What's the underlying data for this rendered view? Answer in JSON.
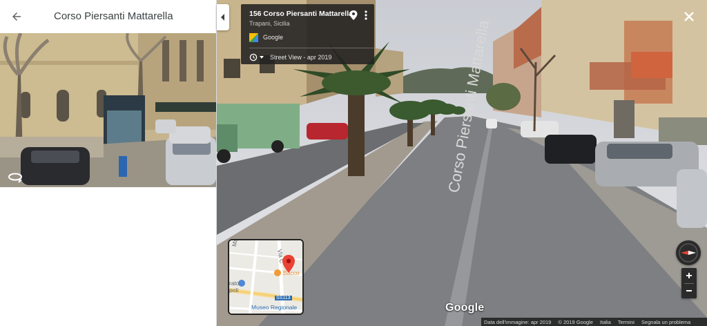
{
  "panel": {
    "title": "Corso Piersanti Mattarella"
  },
  "card": {
    "address": "156 Corso Piersanti Mattarella",
    "city": "Trapani, Sicilia",
    "provider": "Google",
    "history": "Street View - apr 2019"
  },
  "streetview": {
    "road_marking": "Corso Piersanti Mattarella",
    "watermark": "Google"
  },
  "minimap": {
    "labels": {
      "mattarella": "Mattarella",
      "via": "Via C",
      "place": "Bacco",
      "prato": "rato",
      "poli": "poli",
      "road_shield": "SS113",
      "museum": "Museo Regionale"
    }
  },
  "footer": {
    "image_date": "Data dell'immagine: apr 2019",
    "copyright": "© 2019 Google",
    "country": "Italia",
    "terms": "Termini",
    "report": "Segnala un problema"
  },
  "icons": {
    "back": "arrow-back-icon",
    "rotate": "rotate-360-icon",
    "collapse": "chevron-left-icon",
    "pin": "location-pin-icon",
    "more": "more-vert-icon",
    "history": "clock-history-icon",
    "close": "close-icon",
    "compass": "compass-icon"
  },
  "colors": {
    "pin_red": "#ea4335",
    "card_bg": "#222222",
    "road_shield_blue": "#2b6cb0"
  }
}
